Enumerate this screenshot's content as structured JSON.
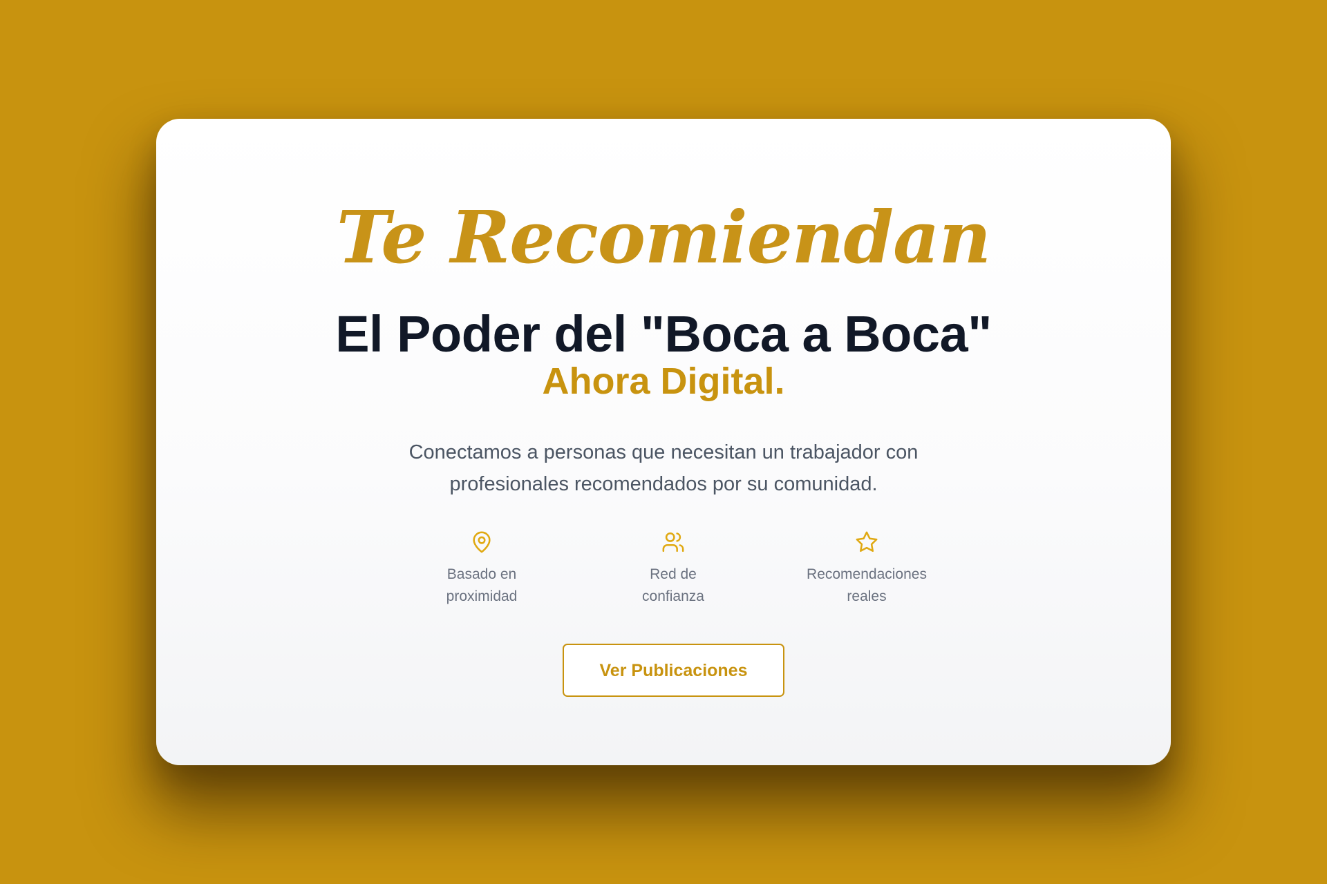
{
  "brand": {
    "name": "Te Recomiendan"
  },
  "hero": {
    "headline": "El Poder del \"Boca a Boca\"",
    "headline_accent": "Ahora Digital.",
    "description_line1": "Conectamos a personas que necesitan un trabajador con",
    "description_line2": "profesionales recomendados por su comunidad."
  },
  "features": [
    {
      "icon": "map-pin-icon",
      "line1": "Basado en",
      "line2": "proximidad"
    },
    {
      "icon": "users-icon",
      "line1": "Red de",
      "line2": "confianza"
    },
    {
      "icon": "star-icon",
      "line1": "Recomendaciones",
      "line2": "reales"
    }
  ],
  "cta": {
    "label": "Ver Publicaciones"
  },
  "colors": {
    "background": "#C8930F",
    "accent": "#C8930F",
    "headline": "#111827",
    "body_text": "#4B5563",
    "muted_text": "#6B7280",
    "card": "#FFFFFF"
  }
}
